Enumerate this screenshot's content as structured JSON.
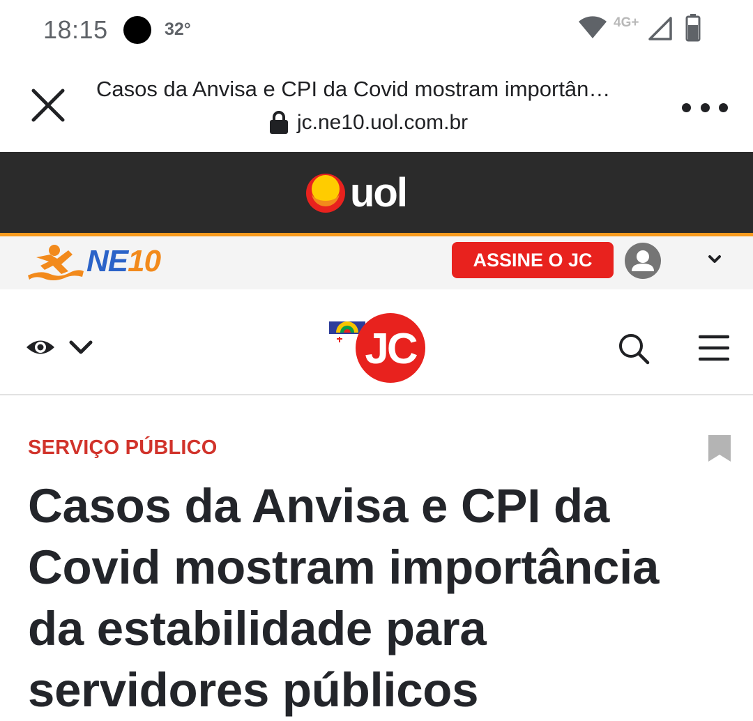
{
  "status_bar": {
    "time": "18:15",
    "temperature": "32°",
    "network": "4G+",
    "icons": [
      "wifi-icon",
      "signal-icon",
      "battery-icon"
    ]
  },
  "toolbar": {
    "page_title": "Casos da Anvisa e CPI da Covid mostram importân…",
    "url": "jc.ne10.uol.com.br",
    "icons": [
      "close-icon",
      "lock-icon",
      "more-options-icon"
    ]
  },
  "uol_bar": {
    "logo_text": "uol",
    "background": "#2b2b2b",
    "accent": "#f79a1e"
  },
  "ne10_bar": {
    "logo_text_a": "NE",
    "logo_text_b": "10",
    "subscribe_label": "ASSINE O JC",
    "subscribe_color": "#e8221e",
    "icons": [
      "user-avatar-icon",
      "chevron-down-icon"
    ]
  },
  "jc_header": {
    "logo_text": "JC",
    "brand_color": "#e8221e",
    "icons": [
      "eye-icon",
      "chevron-down-icon",
      "search-icon",
      "menu-icon"
    ]
  },
  "article": {
    "category": "SERVIÇO PÚBLICO",
    "category_color": "#d1332b",
    "headline": "Casos da Anvisa e CPI da Covid mostram importância da estabilidade para servidores públicos",
    "icons": [
      "bookmark-icon"
    ]
  }
}
